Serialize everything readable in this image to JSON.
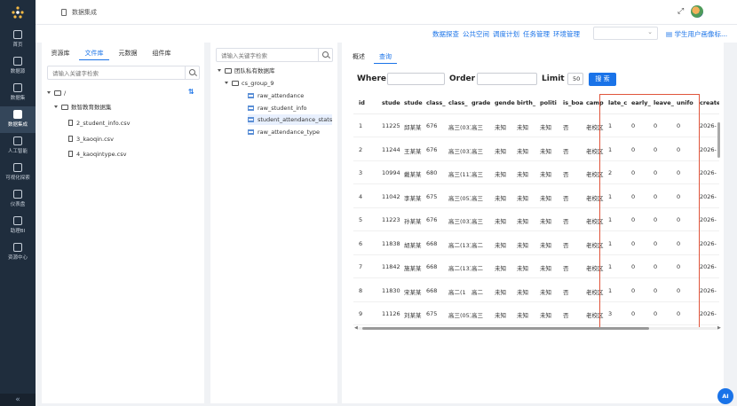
{
  "app": {
    "page_title": "数据集成",
    "avatar_alt": "user avatar"
  },
  "nav": {
    "items": [
      {
        "label": "首页",
        "icon": "home-icon"
      },
      {
        "label": "数据源",
        "icon": "database-icon"
      },
      {
        "label": "数据集",
        "icon": "gear-icon"
      },
      {
        "label": "数据集成",
        "icon": "dataset-icon",
        "active": true
      },
      {
        "label": "人工智能",
        "icon": "ai-icon"
      },
      {
        "label": "可视化探索",
        "icon": "chart-icon"
      },
      {
        "label": "仪表盘",
        "icon": "dashboard-icon"
      },
      {
        "label": "助理BI",
        "icon": "network-icon"
      },
      {
        "label": "资源中心",
        "icon": "folder-icon"
      }
    ],
    "collapse_glyph": "«"
  },
  "toolbar": {
    "links": [
      "数据探查",
      "公共空间",
      "调度计划",
      "任务管理",
      "环境管理"
    ],
    "select_value": "",
    "profile_link": "学生用户画像标..."
  },
  "left_panel": {
    "tabs": [
      "资源库",
      "文件库",
      "元数据",
      "组件库"
    ],
    "active_tab": 1,
    "search_placeholder": "请输入关键字检索",
    "tree": [
      {
        "label": "/",
        "kind": "folder"
      },
      {
        "label": "数智教育数据集",
        "kind": "folder"
      },
      {
        "label": "2_student_info.csv",
        "kind": "file"
      },
      {
        "label": "3_kaoqin.csv",
        "kind": "file"
      },
      {
        "label": "4_kaoqintype.csv",
        "kind": "file"
      }
    ]
  },
  "mid_panel": {
    "search_placeholder": "请输入关键字检索",
    "tree": [
      {
        "label": "团队私有数据库",
        "kind": "folder"
      },
      {
        "label": "cs_group_9",
        "kind": "folder"
      },
      {
        "label": "raw_attendance",
        "kind": "table"
      },
      {
        "label": "raw_student_info",
        "kind": "table"
      },
      {
        "label": "student_attendance_stats",
        "kind": "table",
        "selected": true
      },
      {
        "label": "raw_attendance_type",
        "kind": "table"
      }
    ]
  },
  "query_panel": {
    "tabs": [
      "概述",
      "查询"
    ],
    "active_tab": 1,
    "where_label": "Where",
    "order_label": "Order",
    "limit_label": "Limit",
    "limit_value": "50",
    "search_button": "搜 索",
    "columns": [
      "id",
      "stude",
      "stude",
      "class_",
      "class_",
      "grade",
      "gende",
      "birth_",
      "politi",
      "is_boa",
      "camp",
      "late_c",
      "early_",
      "leave_",
      "unifo",
      "create"
    ],
    "rows": [
      [
        "1",
        "11225",
        "邱某某",
        "676",
        "高三(03)",
        "高三",
        "未知",
        "未知",
        "未知",
        "否",
        "老校区",
        "1",
        "0",
        "0",
        "0",
        "2026-"
      ],
      [
        "2",
        "11244",
        "王某某",
        "676",
        "高三(03)",
        "高三",
        "未知",
        "未知",
        "未知",
        "否",
        "老校区",
        "1",
        "0",
        "0",
        "0",
        "2026-"
      ],
      [
        "3",
        "10994",
        "戴某某",
        "680",
        "高三(11)",
        "高三",
        "未知",
        "未知",
        "未知",
        "否",
        "老校区",
        "2",
        "0",
        "0",
        "0",
        "2026-"
      ],
      [
        "4",
        "11042",
        "李某某",
        "675",
        "高三(05)",
        "高三",
        "未知",
        "未知",
        "未知",
        "否",
        "老校区",
        "1",
        "0",
        "0",
        "0",
        "2026-"
      ],
      [
        "5",
        "11223",
        "孙某某",
        "676",
        "高三(03)",
        "高三",
        "未知",
        "未知",
        "未知",
        "否",
        "老校区",
        "1",
        "0",
        "0",
        "0",
        "2026-"
      ],
      [
        "6",
        "11838",
        "胡某某",
        "668",
        "高二(13)",
        "高二",
        "未知",
        "未知",
        "未知",
        "否",
        "老校区",
        "1",
        "0",
        "0",
        "0",
        "2026-"
      ],
      [
        "7",
        "11842",
        "施某某",
        "668",
        "高二(13)",
        "高二",
        "未知",
        "未知",
        "未知",
        "否",
        "老校区",
        "1",
        "0",
        "0",
        "0",
        "2026-"
      ],
      [
        "8",
        "11830",
        "宋某某",
        "668",
        "高二(1",
        "高二",
        "未知",
        "未知",
        "未知",
        "否",
        "老校区",
        "1",
        "0",
        "0",
        "0",
        "2026-"
      ],
      [
        "9",
        "11126",
        "刘某某",
        "675",
        "高三(05)",
        "高三",
        "未知",
        "未知",
        "未知",
        "否",
        "老校区",
        "3",
        "0",
        "0",
        "0",
        "2026-"
      ]
    ]
  },
  "ai_button": "AI"
}
